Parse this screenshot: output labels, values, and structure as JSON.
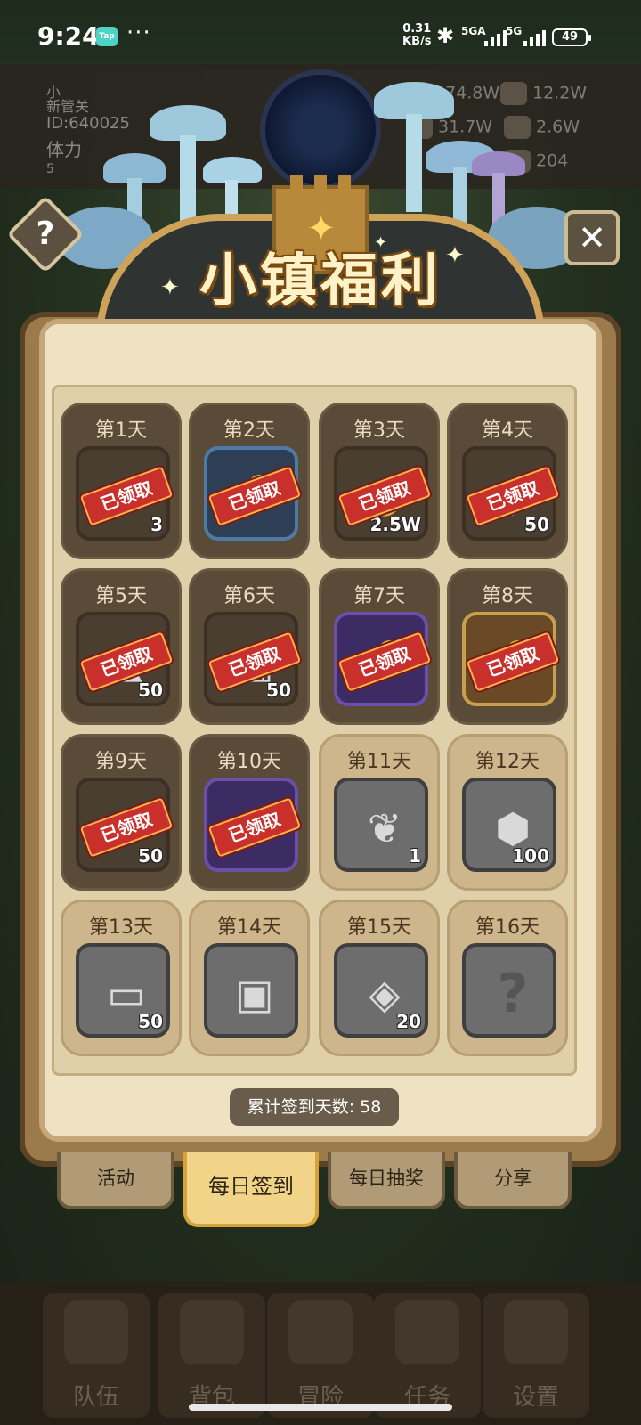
{
  "status_bar": {
    "time": "9:24",
    "tap_badge": "Tap",
    "more": "···",
    "net_speed_value": "0.31",
    "net_speed_unit": "KB/s",
    "sim1_label": "5GA",
    "sim2_label": "5G",
    "battery": "49"
  },
  "hud": {
    "player_name": "小\n新管关",
    "player_id": "ID:640025",
    "stamina_label": "体力",
    "stamina_value": "5",
    "resources": [
      {
        "icon": "gold-coin-icon",
        "value": "474.8W"
      },
      {
        "icon": "iron-icon",
        "value": "12.2W"
      },
      {
        "icon": "ore-icon",
        "value": "31.7W"
      },
      {
        "icon": "leather-icon",
        "value": "2.6W"
      },
      {
        "icon": "gem-icon",
        "value": "204"
      }
    ]
  },
  "modal": {
    "title": "小镇福利",
    "stamp_text": "已领取",
    "checkin_total_label": "累计签到天数: 58",
    "days": [
      {
        "label": "第1天",
        "claimed": true,
        "qty": "3",
        "icon": "potion-icon"
      },
      {
        "label": "第2天",
        "claimed": true,
        "qty": "",
        "icon": "key-icon"
      },
      {
        "label": "第3天",
        "claimed": true,
        "qty": "2.5W",
        "icon": "gold-coins-icon"
      },
      {
        "label": "第4天",
        "claimed": true,
        "qty": "50",
        "icon": "blue-gem-icon"
      },
      {
        "label": "第5天",
        "claimed": true,
        "qty": "50",
        "icon": "ore-icon"
      },
      {
        "label": "第6天",
        "claimed": true,
        "qty": "50",
        "icon": "leather-icon"
      },
      {
        "label": "第7天",
        "claimed": true,
        "qty": "",
        "icon": "key-icon"
      },
      {
        "label": "第8天",
        "claimed": true,
        "qty": "",
        "icon": "key-icon"
      },
      {
        "label": "第9天",
        "claimed": true,
        "qty": "50",
        "icon": "iron-ingot-icon"
      },
      {
        "label": "第10天",
        "claimed": true,
        "qty": "",
        "icon": "dagger-icon"
      },
      {
        "label": "第11天",
        "claimed": false,
        "qty": "1",
        "icon": "feather-icon"
      },
      {
        "label": "第12天",
        "claimed": false,
        "qty": "100",
        "icon": "crystal-icon"
      },
      {
        "label": "第13天",
        "claimed": false,
        "qty": "50",
        "icon": "wood-log-icon"
      },
      {
        "label": "第14天",
        "claimed": false,
        "qty": "",
        "icon": "backpack-icon"
      },
      {
        "label": "第15天",
        "claimed": false,
        "qty": "20",
        "icon": "rune-stone-icon"
      },
      {
        "label": "第16天",
        "claimed": false,
        "qty": "",
        "icon": "mystery-icon"
      }
    ]
  },
  "tabs": [
    {
      "label": "活动",
      "active": false
    },
    {
      "label": "每日签到",
      "active": true
    },
    {
      "label": "每日抽奖",
      "active": false
    },
    {
      "label": "分享",
      "active": false
    }
  ],
  "bottom_nav": [
    {
      "label": "队伍",
      "icon": "helmet-icon"
    },
    {
      "label": "背包",
      "icon": "scroll-icon"
    },
    {
      "label": "冒险",
      "icon": "swords-icon"
    },
    {
      "label": "任务",
      "icon": "quest-icon"
    },
    {
      "label": "设置",
      "icon": "gear-icon"
    }
  ],
  "buttons": {
    "help": "?",
    "close": "✕"
  }
}
